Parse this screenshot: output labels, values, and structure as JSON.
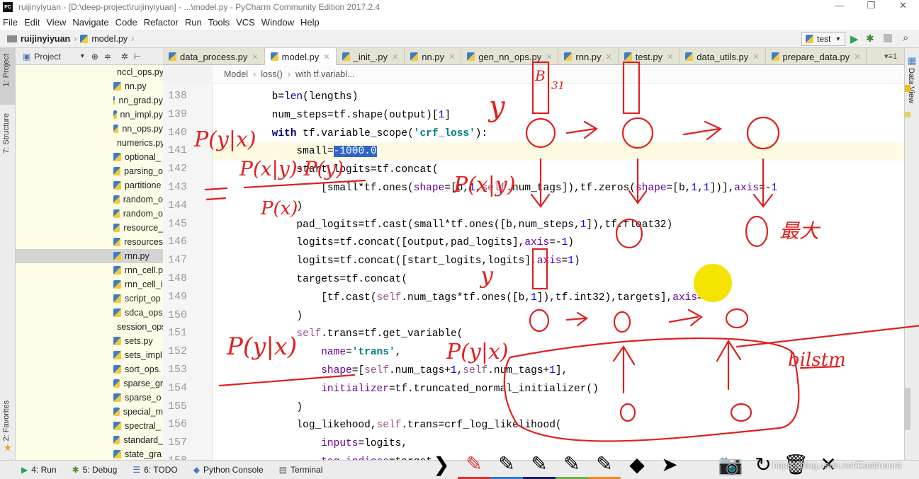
{
  "window": {
    "title": "ruijinyiyuan - [D:\\deep-project\\ruijinyiyuan] - ...\\model.py - PyCharm Community Edition 2017.2.4",
    "logo": "PC"
  },
  "menu": [
    "File",
    "Edit",
    "View",
    "Navigate",
    "Code",
    "Refactor",
    "Run",
    "Tools",
    "VCS",
    "Window",
    "Help"
  ],
  "navbar": {
    "project": "ruijinyiyuan",
    "file": "model.py",
    "run_config": "test"
  },
  "tool_windows": {
    "project": "1: Project",
    "structure": "7: Structure",
    "favorites": "2: Favorites",
    "data_view": "Data View"
  },
  "project_panel": {
    "title": "Project",
    "files": [
      "nccl_ops.py",
      "nn.py",
      "nn_grad.py",
      "nn_impl.py",
      "nn_ops.py",
      "numerics.py",
      "optional_",
      "parsing_o",
      "partitione",
      "random_o",
      "random_o",
      "resource_",
      "resources",
      "rnn.py",
      "rnn_cell.p",
      "rnn_cell_i",
      "script_op",
      "sdca_ops",
      "session_ops.py",
      "sets.py",
      "sets_impl",
      "sort_ops.",
      "sparse_gr",
      "sparse_o",
      "special_m",
      "spectral_",
      "standard_",
      "state_gra"
    ],
    "selected": "rnn.py"
  },
  "tabs": [
    {
      "label": "data_process.py",
      "active": false
    },
    {
      "label": "model.py",
      "active": true
    },
    {
      "label": "_init_.py",
      "active": false
    },
    {
      "label": "nn.py",
      "active": false
    },
    {
      "label": "gen_nn_ops.py",
      "active": false
    },
    {
      "label": "rnn.py",
      "active": false
    },
    {
      "label": "test.py",
      "active": false
    },
    {
      "label": "data_utils.py",
      "active": false
    },
    {
      "label": "prepare_data.py",
      "active": false
    }
  ],
  "tab_overflow": "1",
  "breadcrumb": [
    "Model",
    "loss()",
    "with tf.variabl..."
  ],
  "editor": {
    "current_line": 141,
    "lines": [
      {
        "n": "138",
        "t": [
          [
            "        b=",
            ""
          ],
          [
            "len",
            "bi"
          ],
          [
            "(lengths)",
            ""
          ]
        ]
      },
      {
        "n": "139",
        "t": [
          [
            "        num_steps=tf.shape(output)[",
            ""
          ],
          [
            "1",
            "nm"
          ],
          [
            "]",
            ""
          ]
        ]
      },
      {
        "n": "140",
        "t": [
          [
            "        ",
            ""
          ],
          [
            "with",
            "kw"
          ],
          [
            " tf.variable_scope(",
            ""
          ],
          [
            "'crf_loss'",
            "st"
          ],
          [
            "):",
            ""
          ]
        ]
      },
      {
        "n": "141",
        "t": [
          [
            "            small=",
            ""
          ],
          [
            "-1000.0",
            "hl"
          ]
        ]
      },
      {
        "n": "142",
        "t": [
          [
            "            start_logits=tf.concat(",
            ""
          ]
        ]
      },
      {
        "n": "143",
        "t": [
          [
            "                [small*tf.ones(",
            ""
          ],
          [
            "shape",
            "kwarg"
          ],
          [
            "=[b,",
            ""
          ],
          [
            "1",
            "nm"
          ],
          [
            ",",
            ""
          ],
          [
            "self",
            "sf"
          ],
          [
            ".num_tags]),tf.zeros(",
            ""
          ],
          [
            "shape",
            "kwarg"
          ],
          [
            "=[b,",
            ""
          ],
          [
            "1",
            "nm"
          ],
          [
            ",",
            ""
          ],
          [
            "1",
            "nm"
          ],
          [
            "])],",
            ""
          ],
          [
            "axis",
            "kwarg"
          ],
          [
            "=-",
            ""
          ],
          [
            "1",
            "nm"
          ]
        ]
      },
      {
        "n": "144",
        "t": [
          [
            "            )",
            ""
          ]
        ]
      },
      {
        "n": "145",
        "t": [
          [
            "            pad_logits=tf.cast(small*tf.ones([b,num_steps,",
            ""
          ],
          [
            "1",
            "nm"
          ],
          [
            "]),tf.float32)",
            ""
          ]
        ]
      },
      {
        "n": "146",
        "t": [
          [
            "            logits=tf.concat([output,pad_logits],",
            ""
          ],
          [
            "axis",
            "kwarg"
          ],
          [
            "=-",
            ""
          ],
          [
            "1",
            "nm"
          ],
          [
            ")",
            ""
          ]
        ]
      },
      {
        "n": "147",
        "t": [
          [
            "            logits=tf.concat([start_logits,logits],",
            ""
          ],
          [
            "axis",
            "kwarg"
          ],
          [
            "=",
            ""
          ],
          [
            "1",
            "nm"
          ],
          [
            ")",
            ""
          ]
        ]
      },
      {
        "n": "148",
        "t": [
          [
            "            targets=tf.concat(",
            ""
          ]
        ]
      },
      {
        "n": "149",
        "t": [
          [
            "                [tf.cast(",
            ""
          ],
          [
            "self",
            "sf"
          ],
          [
            ".num_tags*tf.ones([b,",
            ""
          ],
          [
            "1",
            "nm"
          ],
          [
            "]),tf.int32),targets],",
            ""
          ],
          [
            "axis",
            "kwarg"
          ],
          [
            "=-",
            ""
          ],
          [
            "1",
            "nm"
          ]
        ]
      },
      {
        "n": "150",
        "t": [
          [
            "            )",
            ""
          ]
        ]
      },
      {
        "n": "151",
        "t": [
          [
            "            ",
            ""
          ],
          [
            "self",
            "sf"
          ],
          [
            ".trans=tf.get_variable(",
            ""
          ]
        ]
      },
      {
        "n": "152",
        "t": [
          [
            "                ",
            ""
          ],
          [
            "name",
            "kwarg"
          ],
          [
            "=",
            ""
          ],
          [
            "'trans'",
            "st"
          ],
          [
            ",",
            ""
          ]
        ]
      },
      {
        "n": "153",
        "t": [
          [
            "                ",
            ""
          ],
          [
            "shape",
            "kwarg"
          ],
          [
            "=[",
            ""
          ],
          [
            "self",
            "sf"
          ],
          [
            ".num_tags+",
            ""
          ],
          [
            "1",
            "nm"
          ],
          [
            ",",
            ""
          ],
          [
            "self",
            "sf"
          ],
          [
            ".num_tags+",
            ""
          ],
          [
            "1",
            "nm"
          ],
          [
            "],",
            ""
          ]
        ]
      },
      {
        "n": "154",
        "t": [
          [
            "                ",
            ""
          ],
          [
            "initializer",
            "kwarg"
          ],
          [
            "=tf.truncated_normal_initializer()",
            ""
          ]
        ]
      },
      {
        "n": "155",
        "t": [
          [
            "            )",
            ""
          ]
        ]
      },
      {
        "n": "156",
        "t": [
          [
            "            log_likehood,",
            ""
          ],
          [
            "self",
            "sf"
          ],
          [
            ".trans=crf_log_likelihood(",
            ""
          ]
        ]
      },
      {
        "n": "157",
        "t": [
          [
            "                ",
            ""
          ],
          [
            "inputs",
            "kwarg"
          ],
          [
            "=logits,",
            ""
          ]
        ]
      },
      {
        "n": "158",
        "t": [
          [
            "                ",
            ""
          ],
          [
            "tag_indices",
            "kwarg"
          ],
          [
            "=target",
            ""
          ]
        ]
      }
    ]
  },
  "bottom_tools": [
    {
      "label": "4: Run",
      "icon": "run-icon",
      "color": "#2aa34a"
    },
    {
      "label": "5: Debug",
      "icon": "bug-icon",
      "color": "#4a8a2a"
    },
    {
      "label": "6: TODO",
      "icon": "todo-icon",
      "color": "#3a6ab0"
    },
    {
      "label": "Python Console",
      "icon": "python-icon",
      "color": "#3f7cc4"
    },
    {
      "label": "Terminal",
      "icon": "terminal-icon",
      "color": "#666666"
    }
  ],
  "pen_toolbar": {
    "tools": [
      "collapse",
      "pen-red",
      "pen-blue",
      "pen-navy",
      "pen-green",
      "pen-orange",
      "eraser",
      "pointer",
      "camera",
      "undo",
      "trash",
      "close"
    ],
    "pen_colors": [
      "#e03030",
      "#2f7ad8",
      "#1a1a6a",
      "#6ab04a",
      "#f08a20"
    ]
  },
  "watermark": "https://blog.csdn.net/Eastmount",
  "annotations": {
    "color": "#e02020",
    "labels": [
      "P(y|x)",
      "P(x|y)·P(y)",
      "P(x)",
      "P(x|y)",
      "y",
      "P(y|x)",
      "P(y|x)",
      "bilstm",
      "最大",
      "B",
      "31",
      "y"
    ]
  },
  "accent": {
    "selection": "#2f65ca",
    "tree_bg": "#fdfce6",
    "current_line": "#fdfbe2"
  }
}
